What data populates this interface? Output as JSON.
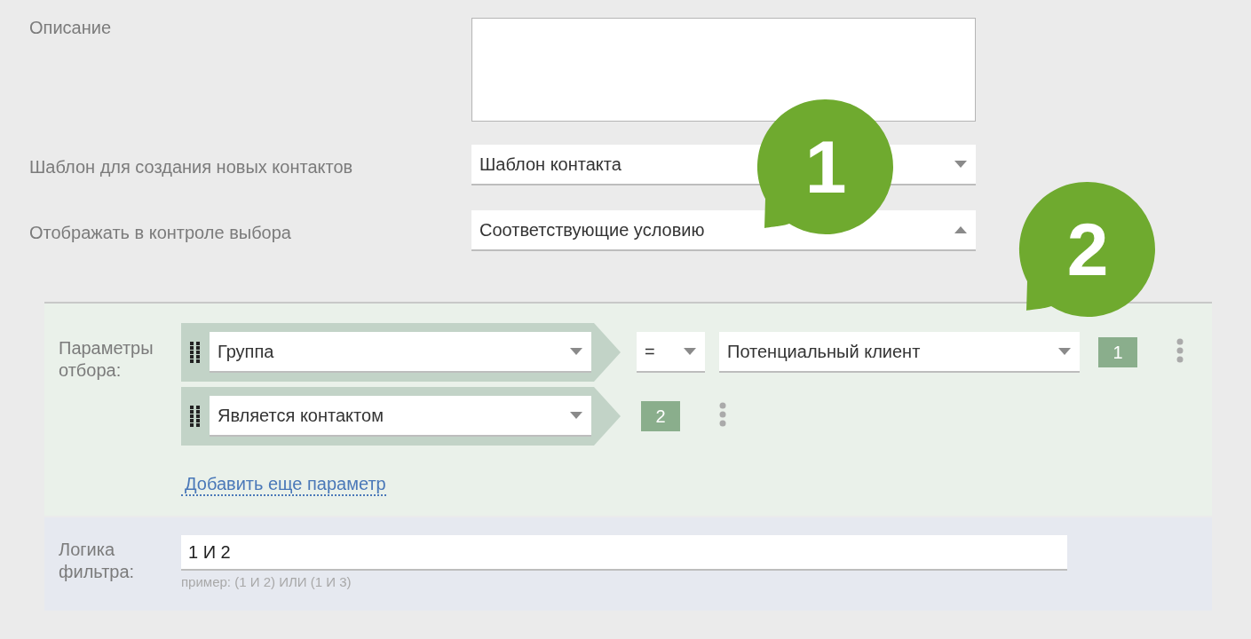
{
  "fields": [
    {
      "kind": "textarea",
      "label": "Описание"
    },
    {
      "kind": "select",
      "label": "Шаблон для создания новых контактов",
      "value": "Шаблон контакта",
      "expanded": false
    },
    {
      "kind": "select",
      "label": "Отображать в контроле выбора",
      "value": "Соответствующие условию",
      "expanded": true
    }
  ],
  "filter": {
    "label": "Параметры отбора:",
    "rows": [
      {
        "column": "Группа",
        "operator": "=",
        "value": "Потенциальный клиент",
        "number": "1"
      },
      {
        "column": "Является контактом",
        "number": "2"
      }
    ],
    "add_link": "Добавить еще параметр"
  },
  "logic": {
    "label": "Логика фильтра:",
    "value": "1 И 2",
    "hint": "пример: (1 И 2) ИЛИ (1 И 3)"
  },
  "callouts": [
    "1",
    "2"
  ]
}
